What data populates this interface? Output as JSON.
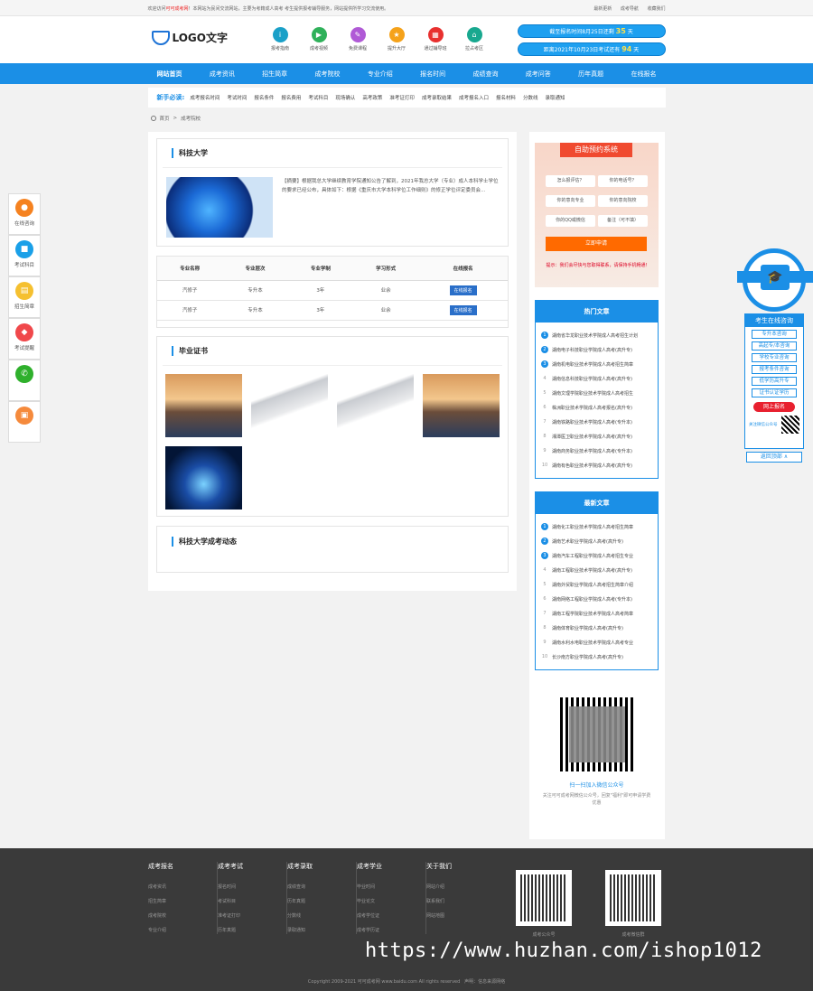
{
  "topbar": {
    "welcome": "欢迎访问",
    "site_name": "可可成考网",
    "notice": "！本网站为民间交流网站，主要为考籍成人高考 考生提供报考辅导服务，网站提供所学习交流使用。",
    "links": [
      "最新更新",
      "成考导航",
      "收藏我们"
    ]
  },
  "header": {
    "logo_text": "LOGO文字",
    "quick": [
      {
        "label": "报考指南",
        "color": "#1aa0c8",
        "icon": "info-icon",
        "glyph": "i"
      },
      {
        "label": "成考视频",
        "color": "#2fb15a",
        "icon": "video-icon",
        "glyph": "▶"
      },
      {
        "label": "免费课程",
        "color": "#b05ad6",
        "icon": "course-icon",
        "glyph": "✎"
      },
      {
        "label": "提升大厅",
        "color": "#f5a21a",
        "icon": "hall-icon",
        "glyph": "★"
      },
      {
        "label": "通过辅导班",
        "color": "#e8302f",
        "icon": "class-icon",
        "glyph": "▦"
      },
      {
        "label": "拉占考区",
        "color": "#18a88f",
        "icon": "area-icon",
        "glyph": "⌂"
      }
    ],
    "countdown1_prefix": "截至报名时间8月25日还剩",
    "countdown1_days": "35",
    "countdown1_suffix": "天",
    "countdown2_prefix": "距离2021年10月23日考试还有",
    "countdown2_days": "94",
    "countdown2_suffix": "天"
  },
  "nav": [
    "网站首页",
    "成考资讯",
    "招生简章",
    "成考院校",
    "专业介绍",
    "报名时间",
    "成绩查询",
    "成考问答",
    "历年真题",
    "在线报名"
  ],
  "subnav": {
    "label": "新手必读:",
    "items": [
      "成考报名时间",
      "考试时间",
      "报名条件",
      "报名费用",
      "考试科目",
      "现场确认",
      "高考政策",
      "准考证打印",
      "成考录取结果",
      "成考报名入口",
      "报名材料",
      "分数线",
      "录取通知"
    ]
  },
  "breadcrumb": {
    "home": "首页",
    "sep": ">",
    "current": "成考院校"
  },
  "school": {
    "title": "科技大学",
    "intro": "【摘要】根据我总大学继续教育学院通知公告了解到，2021年我总大学（专业）成人本科学士学位的要求已经公布，具体如下：根据《重庆市大学本科学位工作细则》的修正学位评定委员会..."
  },
  "majors": {
    "headers": [
      "专业名称",
      "专业层次",
      "专业学制",
      "学习形式",
      "在线报名"
    ],
    "rows": [
      [
        "汽修子",
        "专升本",
        "3年",
        "业余",
        "在线报名"
      ],
      [
        "汽修子",
        "专升本",
        "3年",
        "业余",
        "在线报名"
      ]
    ]
  },
  "certificate": {
    "title": "毕业证书"
  },
  "news": {
    "title": "科技大学成考动态"
  },
  "appointment": {
    "title": "自助预约系统",
    "options": [
      "怎么报评估？",
      "你的电话号？",
      "你的意向专业",
      "你的意向院校",
      "你的QQ或微信",
      "备注（可不填）"
    ],
    "submit": "立即申请",
    "tip": "提示：我们会尽快与您取得联系，请保持手机畅通！"
  },
  "hot": {
    "title": "热门文章",
    "items": [
      "湖南省华龙职业技术学院成人高考招生计划",
      "湖南电子科技职业学院成人高考(高升专)",
      "湖南机电职业技术学院成人高考招生简章",
      "湖南信息科技职业学院成人高考(高升专)",
      "湖南文理学院职业技术学院成人高考招生",
      "株洲职业技术学院成人高考报名(高升专)",
      "湖南铁路职业技术学院成人高考(专升本)",
      "湘潭医卫职业技术学院成人高考(高升专)",
      "湖南商务职业技术学院成人高考(专升本)",
      "湖南有色职业技术学院成人高考(高升专)"
    ]
  },
  "latest": {
    "title": "最新文章",
    "items": [
      "湖南化工职业技术学院成人高考招生简章",
      "湖南艺术职业学院成人高考(高升专)",
      "湖南汽车工程职业学院成人高考招生专业",
      "湖南工程职业技术学院成人高考(高升专)",
      "湖南外贸职业学院成人高考招生简章介绍",
      "湖南网络工程职业学院成人高考(专升本)",
      "湖南工程学院职业技术学院成人高考简章",
      "湖南体育职业学院成人高考(高升专)",
      "湖南水利水电职业技术学院成人高考专业",
      "长沙南方职业学院成人高考(高升专)"
    ]
  },
  "wechat": {
    "title": "扫一扫加入微信公众号",
    "desc": "关注可可成考网微信公众号，回复\"福利\"即可申请学费优惠"
  },
  "leftfloat": [
    {
      "label": "在线咨询",
      "color": "#f58220",
      "icon": "user-icon",
      "glyph": "●"
    },
    {
      "label": "考试科目",
      "color": "#1aa0e8",
      "icon": "book-icon",
      "glyph": "■"
    },
    {
      "label": "招生简章",
      "color": "#f5c030",
      "icon": "doc-icon",
      "glyph": "▤"
    },
    {
      "label": "考试提醒",
      "color": "#f0484b",
      "icon": "bell-icon",
      "glyph": "◆"
    },
    {
      "label": "",
      "color": "#2fb02c",
      "icon": "wechat-icon",
      "glyph": "✆"
    },
    {
      "label": "",
      "color": "#f58a3c",
      "icon": "wallet-icon",
      "glyph": "▣"
    }
  ],
  "rightfloat": {
    "header": "考生在线咨询",
    "links": [
      "专升本咨询",
      "高起专/本咨询",
      "学校专业咨询",
      "报考条件咨询",
      "低学历高升专",
      "证书认证学历"
    ],
    "sign": "网上报名",
    "qr_label": "关注微信公众号",
    "back_top": "返回顶部 ∧"
  },
  "footer": {
    "cols": [
      {
        "title": "成考报名",
        "links": [
          "成考资讯",
          "招生简章",
          "成考院校",
          "专业介绍"
        ]
      },
      {
        "title": "成考考试",
        "links": [
          "报名时间",
          "考试科目",
          "准考证打印",
          "历年真题"
        ]
      },
      {
        "title": "成考录取",
        "links": [
          "成绩查询",
          "历年真题",
          "分数线",
          "录取通知"
        ]
      },
      {
        "title": "成考学业",
        "links": [
          "毕业时间",
          "毕业论文",
          "成考学位证",
          "成考学历证"
        ]
      },
      {
        "title": "关于我们",
        "links": [
          "网站介绍",
          "联系我们",
          "网站地图"
        ]
      }
    ],
    "qr1": "成考公众号",
    "qr2": "成考微信群",
    "copyright": "Copyright 2009-2021 可可成考网 www.baidu.com All rights reserved",
    "statement": "声明：信息来源网络"
  },
  "watermark": "https://www.huzhan.com/ishop1012"
}
